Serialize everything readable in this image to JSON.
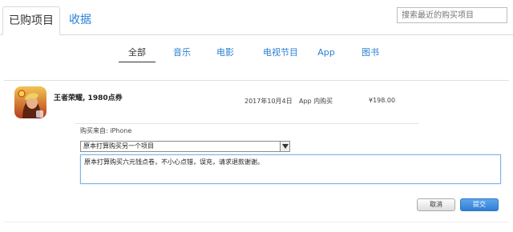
{
  "top_tabs": {
    "purchased": "已购项目",
    "wishlist": "收据"
  },
  "search": {
    "placeholder": "搜索最近的购买项目"
  },
  "category_tabs": [
    {
      "label": "全部",
      "active": true
    },
    {
      "label": "音乐"
    },
    {
      "label": "电影"
    },
    {
      "label": "电视节目"
    },
    {
      "label": "App"
    },
    {
      "label": "图书"
    }
  ],
  "item": {
    "title": "王者荣耀, 1980点券",
    "date": "2017年10月4日",
    "type": "App 内购买",
    "price": "¥198.00",
    "app_icon": "game-hero-app-icon"
  },
  "form": {
    "from_label": "购买来自: iPhone",
    "reason_selected": "原本打算购买另一个项目",
    "reason_text": "原本打算购买六元钱点卷，不小心点错，误充，请求退款谢谢。",
    "cancel_label": "取消",
    "submit_label": "提交"
  },
  "colors": {
    "link": "#2a7fd2",
    "submit": "#2f7fd1"
  }
}
